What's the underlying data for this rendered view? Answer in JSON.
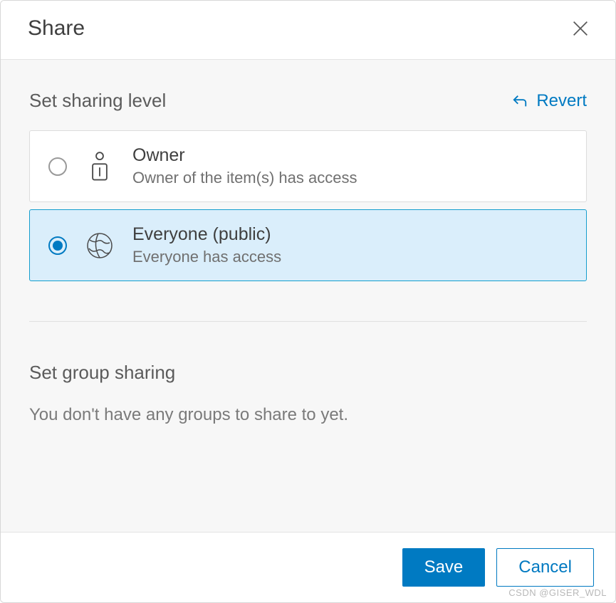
{
  "dialog": {
    "title": "Share"
  },
  "sharing_level": {
    "title": "Set sharing level",
    "revert_label": "Revert",
    "options": [
      {
        "id": "owner",
        "title": "Owner",
        "desc": "Owner of the item(s) has access",
        "selected": false
      },
      {
        "id": "everyone",
        "title": "Everyone (public)",
        "desc": "Everyone has access",
        "selected": true
      }
    ]
  },
  "group_sharing": {
    "title": "Set group sharing",
    "empty_msg": "You don't have any groups to share to yet."
  },
  "footer": {
    "save_label": "Save",
    "cancel_label": "Cancel"
  },
  "watermark": "CSDN @GISER_WDL"
}
